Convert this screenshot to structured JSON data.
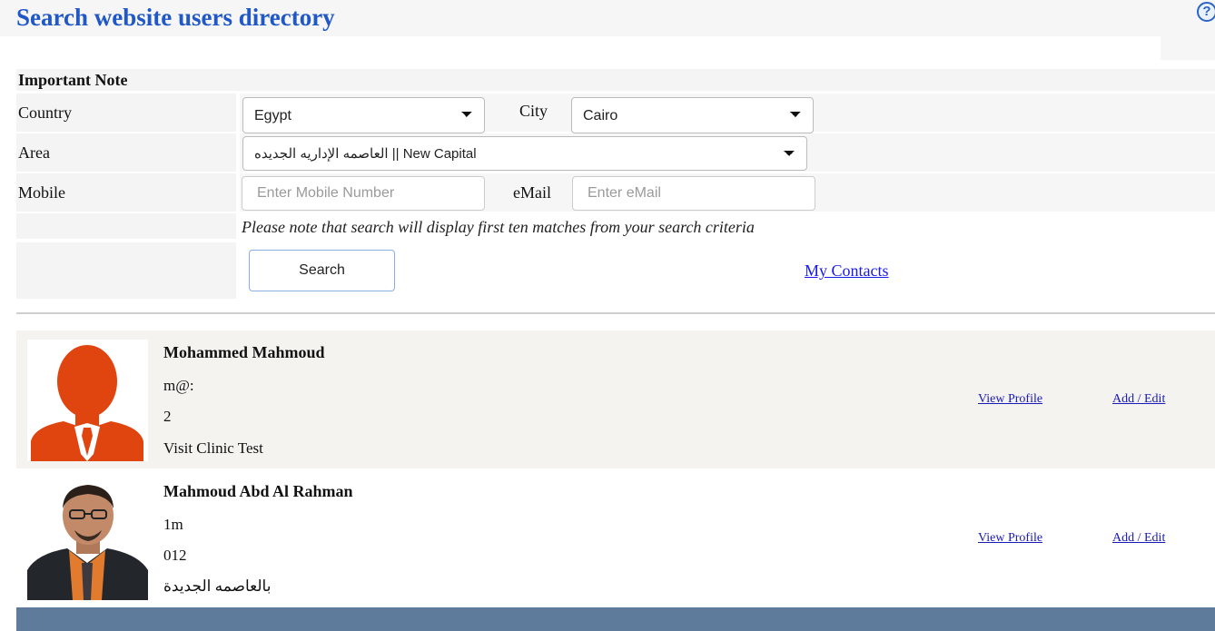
{
  "page": {
    "title": "Search website users directory",
    "help_icon": "help-icon"
  },
  "form": {
    "note_title": "Important Note",
    "country_label": "Country",
    "country_value": "Egypt",
    "city_label": "City",
    "city_value": "Cairo",
    "area_label": "Area",
    "area_value": "العاصمه الإداريه الجديده || New Capital",
    "mobile_label": "Mobile",
    "mobile_placeholder": "Enter Mobile Number",
    "email_label": "eMail",
    "email_placeholder": "Enter eMail",
    "hint": "Please note that search will display first ten matches from your search criteria",
    "search_button": "Search",
    "contacts_link": "My Contacts"
  },
  "results": [
    {
      "name": "Mohammed Mahmoud",
      "line1": "m@:",
      "line2": "2",
      "line3": "Visit Clinic Test",
      "avatar": "default-user-avatar",
      "view_profile": "View Profile",
      "add_edit": "Add / Edit"
    },
    {
      "name": "Mahmoud Abd Al Rahman",
      "line1": "1m",
      "line2": "012",
      "line3": "بالعاصمه الجديدة",
      "avatar": "user-photo",
      "view_profile": "View Profile",
      "add_edit": "Add / Edit"
    }
  ],
  "colors": {
    "title": "#2158c7",
    "link": "#1a1ae6",
    "footer": "#5e7b9b",
    "avatar_orange": "#e0440f"
  }
}
